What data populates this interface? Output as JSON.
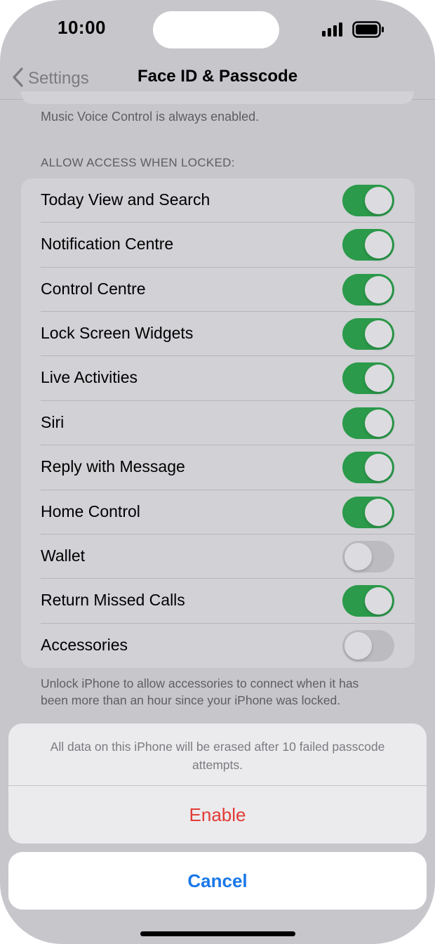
{
  "status": {
    "time": "10:00"
  },
  "nav": {
    "back_label": "Settings",
    "title": "Face ID & Passcode"
  },
  "note_top": "Music Voice Control is always enabled.",
  "section_header": "ALLOW ACCESS WHEN LOCKED:",
  "items": [
    {
      "label": "Today View and Search",
      "on": true
    },
    {
      "label": "Notification Centre",
      "on": true
    },
    {
      "label": "Control Centre",
      "on": true
    },
    {
      "label": "Lock Screen Widgets",
      "on": true
    },
    {
      "label": "Live Activities",
      "on": true
    },
    {
      "label": "Siri",
      "on": true
    },
    {
      "label": "Reply with Message",
      "on": true
    },
    {
      "label": "Home Control",
      "on": true
    },
    {
      "label": "Wallet",
      "on": false
    },
    {
      "label": "Return Missed Calls",
      "on": true
    },
    {
      "label": "Accessories",
      "on": false
    }
  ],
  "footnote": "Unlock iPhone to allow accessories to connect when it has been more than an hour since your iPhone was locked.",
  "sheet": {
    "message": "All data on this iPhone will be erased after 10 failed passcode attempts.",
    "enable_label": "Enable",
    "cancel_label": "Cancel"
  },
  "colors": {
    "toggle_on": "#2b9a4a",
    "destructive": "#e23b36",
    "accent": "#1a78e8"
  }
}
